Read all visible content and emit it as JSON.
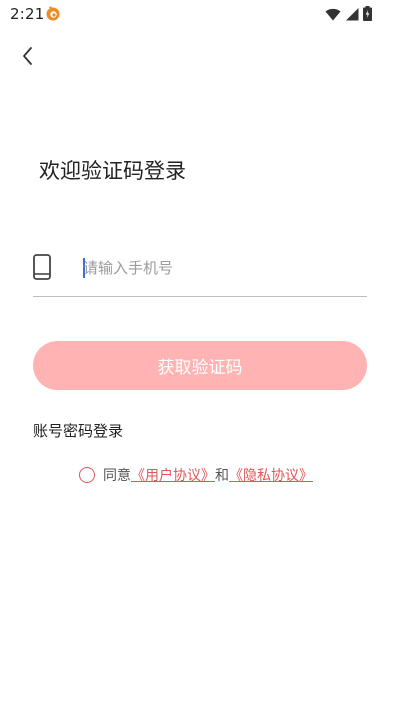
{
  "status_bar": {
    "time": "2:21",
    "icons": [
      "app-notification-icon",
      "wifi-icon",
      "signal-icon",
      "battery-icon"
    ]
  },
  "nav": {
    "back_icon": "chevron-left-icon"
  },
  "title": "欢迎验证码登录",
  "phone_field": {
    "placeholder": "请输入手机号",
    "value": "",
    "icon": "phone-icon"
  },
  "get_code_button": {
    "label": "获取验证码",
    "color": "#ffb3b3"
  },
  "password_login_label": "账号密码登录",
  "agreement": {
    "prefix": "同意",
    "user_agreement": "《用户协议》",
    "conjunction": "和",
    "privacy_policy": "《隐私协议》",
    "accent_color": "#e0575b"
  }
}
